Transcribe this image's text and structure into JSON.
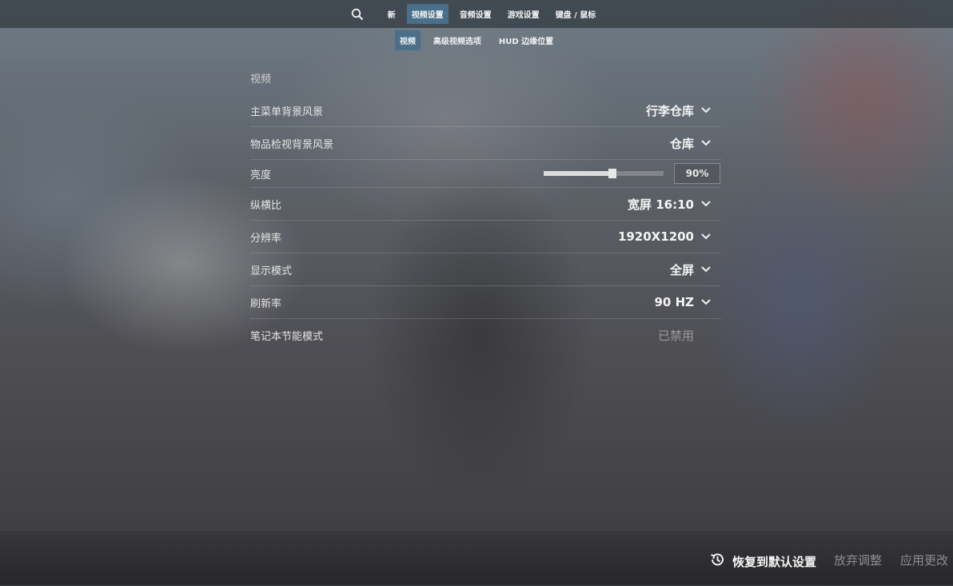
{
  "topnav": {
    "search_icon": "search-icon",
    "tabs": [
      {
        "label": "新"
      },
      {
        "label": "视频设置",
        "active": true
      },
      {
        "label": "音频设置"
      },
      {
        "label": "游戏设置"
      },
      {
        "label": "键盘 / 鼠标"
      }
    ]
  },
  "subnav": {
    "tabs": [
      {
        "label": "视频",
        "active": true
      },
      {
        "label": "高级视频选项"
      },
      {
        "label": "HUD 边缘位置"
      }
    ]
  },
  "section": {
    "title": "视频",
    "rows": [
      {
        "label": "主菜单背景风景",
        "value": "行李仓库"
      },
      {
        "label": "物品检视背景风景",
        "value": "仓库"
      },
      {
        "label": "亮度",
        "value": "90%",
        "slider_fraction": 0.57
      },
      {
        "label": "纵横比",
        "value": "宽屏 16:10"
      },
      {
        "label": "分辨率",
        "value": "1920X1200"
      },
      {
        "label": "显示模式",
        "value": "全屏"
      },
      {
        "label": "刷新率",
        "value": "90 HZ"
      },
      {
        "label": "笔记本节能模式",
        "value": "已禁用"
      }
    ]
  },
  "bottom": {
    "restore_label": "恢复到默认设置",
    "discard_label": "放弃调整",
    "apply_label": "应用更改"
  },
  "colors": {
    "accent_tab": "#4a6f8a"
  }
}
